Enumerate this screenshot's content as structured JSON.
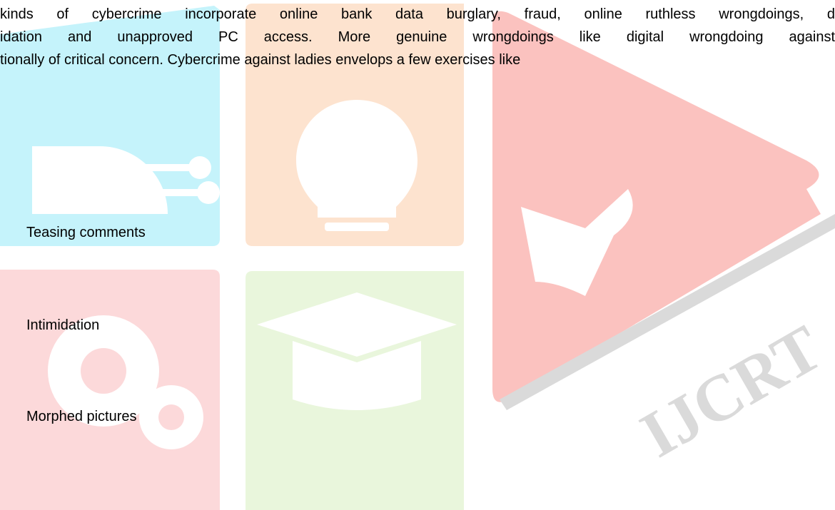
{
  "document": {
    "paragraph_lines": [
      "kinds of cybercrime incorporate online bank data burglary, fraud, online ruthless wrongdoings, d",
      "idation and unapproved PC access. More genuine wrongdoings like digital wrongdoing against",
      "tionally of critical concern. Cybercrime against ladies envelops a few exercises like"
    ],
    "list_items": [
      "Teasing comments",
      "Intimidation",
      "Morphed pictures"
    ]
  },
  "watermark": {
    "logo_text": "IJCRT",
    "colors": {
      "cyan": "#c5f3fb",
      "orange": "#fde3cf",
      "pink": "#fcd9da",
      "green": "#e9f6dc",
      "red": "#fbc2bf",
      "gray": "#dadada"
    },
    "icons": [
      "circuit-icon",
      "lightbulb-icon",
      "gears-icon",
      "graduation-cap-icon",
      "open-book-icon"
    ]
  }
}
